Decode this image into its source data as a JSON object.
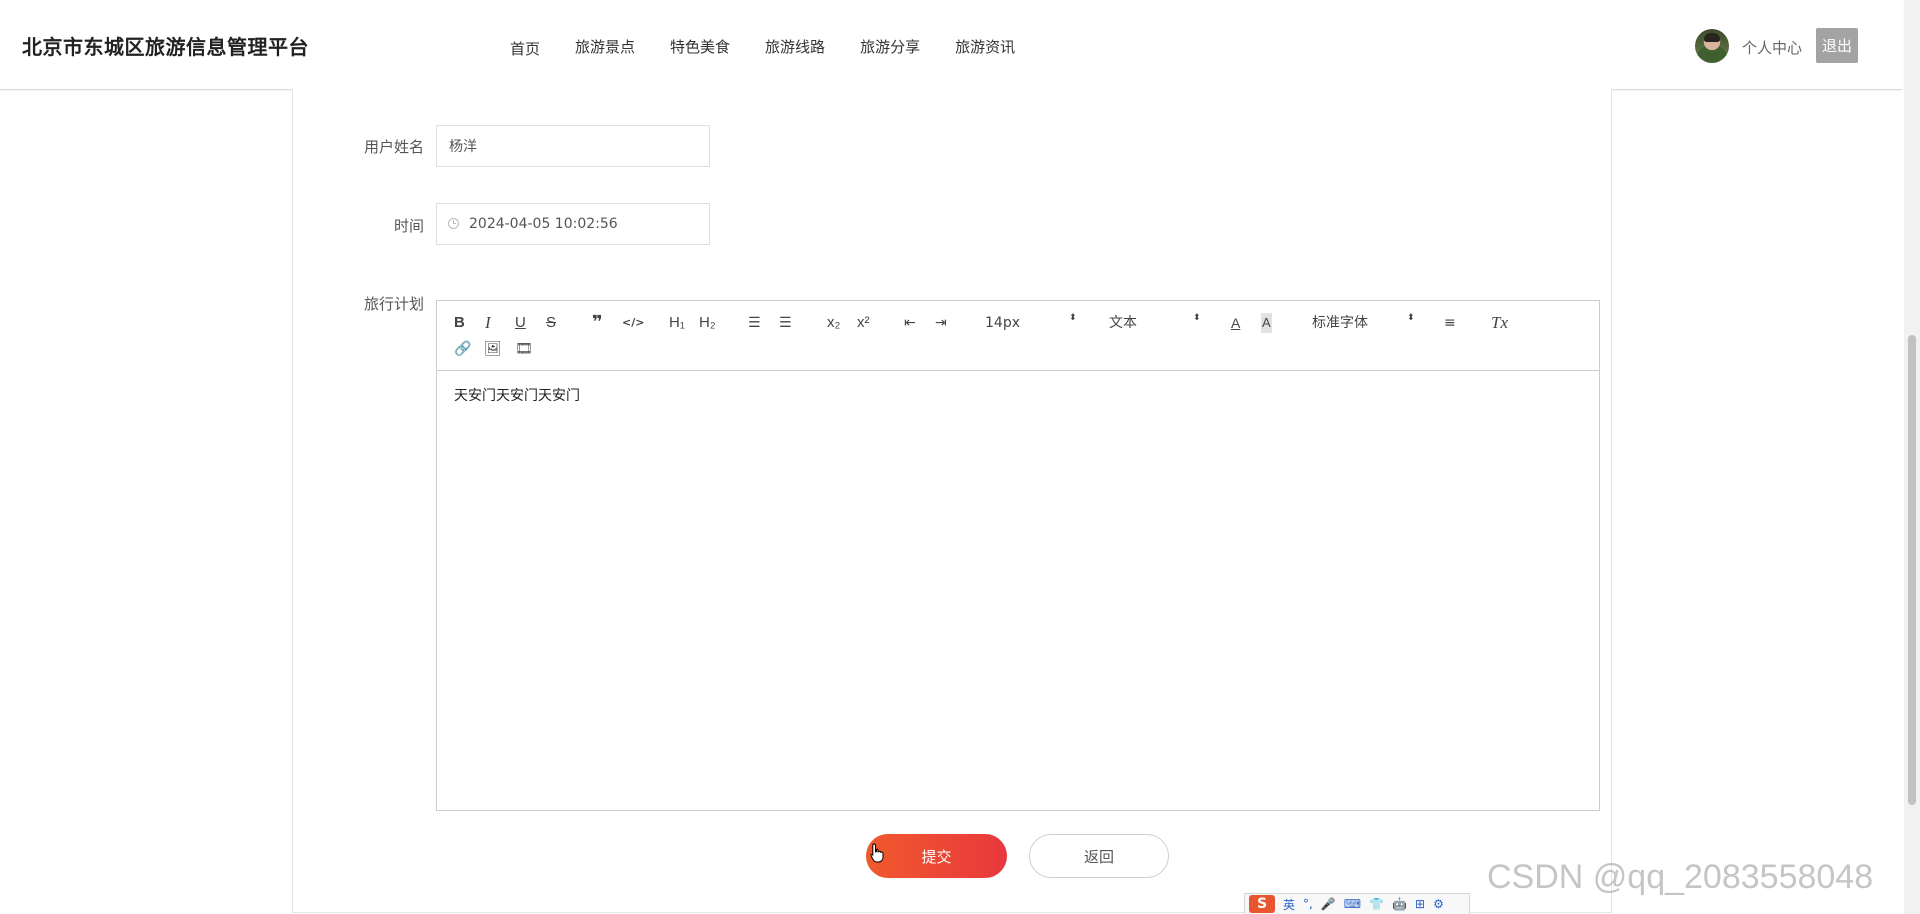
{
  "header": {
    "site_title": "北京市东城区旅游信息管理平台",
    "nav": [
      "首页",
      "旅游景点",
      "特色美食",
      "旅游线路",
      "旅游分享",
      "旅游资讯"
    ],
    "user_center": "个人中心",
    "logout": "退出"
  },
  "form": {
    "name_label": "用户姓名",
    "name_value": "杨洋",
    "time_label": "时间",
    "time_value": "2024-04-05 10:02:56",
    "plan_label": "旅行计划",
    "plan_content": "天安门天安门天安门"
  },
  "editor": {
    "bold": "B",
    "italic": "I",
    "underline": "U",
    "strike": "S",
    "quote": "❞",
    "code": "</>",
    "h1": "H₁",
    "h2": "H₂",
    "ordered_list": "☰",
    "bullet_list": "☰",
    "subscript": "x₂",
    "superscript": "x²",
    "outdent": "⇤",
    "indent": "⇥",
    "size_select": "14px",
    "format_select": "文本",
    "color": "A",
    "background": "A",
    "font_select": "标准字体",
    "align": "≡",
    "clean": "Tx",
    "link": "🔗",
    "image": "🖼",
    "video": "🎞",
    "caret": "⬍"
  },
  "buttons": {
    "submit": "提交",
    "back": "返回"
  },
  "watermark": "CSDN @qq_2083558048",
  "ime": {
    "logo": "S",
    "lang": "英",
    "icons": [
      "°,",
      "🎤",
      "⌨",
      "👕",
      "🤖",
      "⊞",
      "⚙"
    ]
  }
}
